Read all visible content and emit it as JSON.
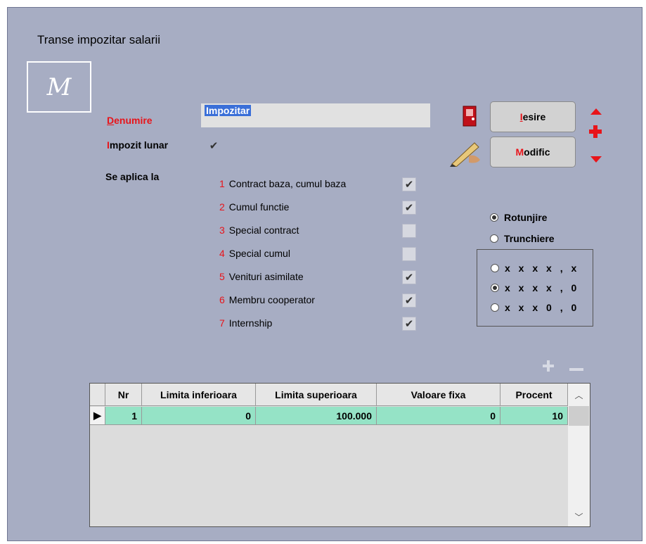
{
  "window": {
    "title": "Transe impozitar salarii",
    "logo_text": "M"
  },
  "form": {
    "denumire_label_first": "D",
    "denumire_label_rest": "enumire",
    "denumire_value": "Impozitar",
    "impozit_lunar_first": "I",
    "impozit_lunar_rest": "mpozit lunar",
    "se_aplica_label": "Se aplica la",
    "applies": [
      {
        "num": "1",
        "label": "Contract baza, cumul baza",
        "checked": true
      },
      {
        "num": "2",
        "label": "Cumul functie",
        "checked": true
      },
      {
        "num": "3",
        "label": "Special contract",
        "checked": false
      },
      {
        "num": "4",
        "label": "Special cumul",
        "checked": false
      },
      {
        "num": "5",
        "label": "Venituri asimilate",
        "checked": true
      },
      {
        "num": "6",
        "label": "Membru cooperator",
        "checked": true
      },
      {
        "num": "7",
        "label": "Internship",
        "checked": true
      }
    ]
  },
  "buttons": {
    "iesire_first": "I",
    "iesire_rest": "esire",
    "modific_first": "M",
    "modific_rest": "odific"
  },
  "rounding": {
    "rotunjire": "Rotunjire",
    "trunchiere": "Trunchiere",
    "selected": "Rotunjire",
    "formats": [
      "x x x x , x",
      "x x x x , 0",
      "x x x 0 , 0"
    ],
    "selected_format": "x x x x , 0"
  },
  "table": {
    "columns": [
      "Nr",
      "Limita inferioara",
      "Limita superioara",
      "Valoare fixa",
      "Procent"
    ],
    "rows": [
      {
        "nr": "1",
        "inf": "0",
        "sup": "100.000",
        "fix": "0",
        "proc": "10"
      }
    ]
  },
  "colors": {
    "background": "#a7adc3",
    "accent_red": "#e8141a",
    "row_green": "#95e3c6"
  }
}
